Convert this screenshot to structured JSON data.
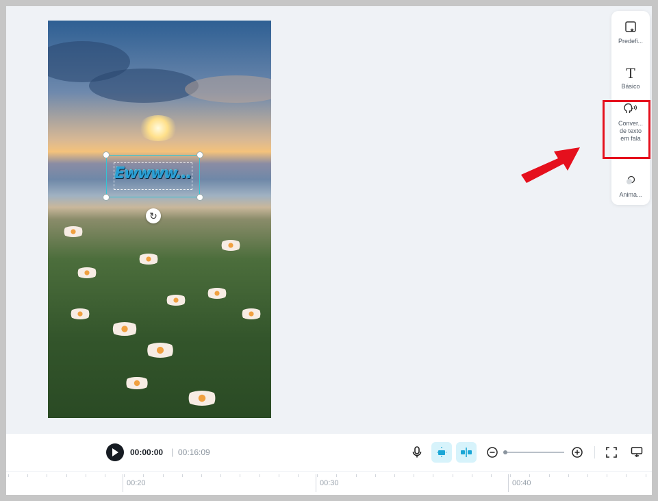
{
  "canvas": {
    "overlay_text": "Ewwww..."
  },
  "side_panel": {
    "items": [
      {
        "label": "Predefi...",
        "icon": "preset-icon"
      },
      {
        "label": "Básico",
        "icon": "text-icon"
      },
      {
        "label": "Conver... de texto em fala",
        "icon": "speaking-head-icon"
      },
      {
        "label": "Anima...",
        "icon": "animation-icon"
      }
    ]
  },
  "player": {
    "current_time": "00:00:00",
    "separator": "|",
    "total_time": "00:16:09"
  },
  "timeline": {
    "labels": [
      "00:20",
      "00:30",
      "00:40"
    ]
  },
  "colors": {
    "highlight": "#e5101d",
    "accent": "#1aa6d6",
    "selection": "#34c4d4"
  }
}
